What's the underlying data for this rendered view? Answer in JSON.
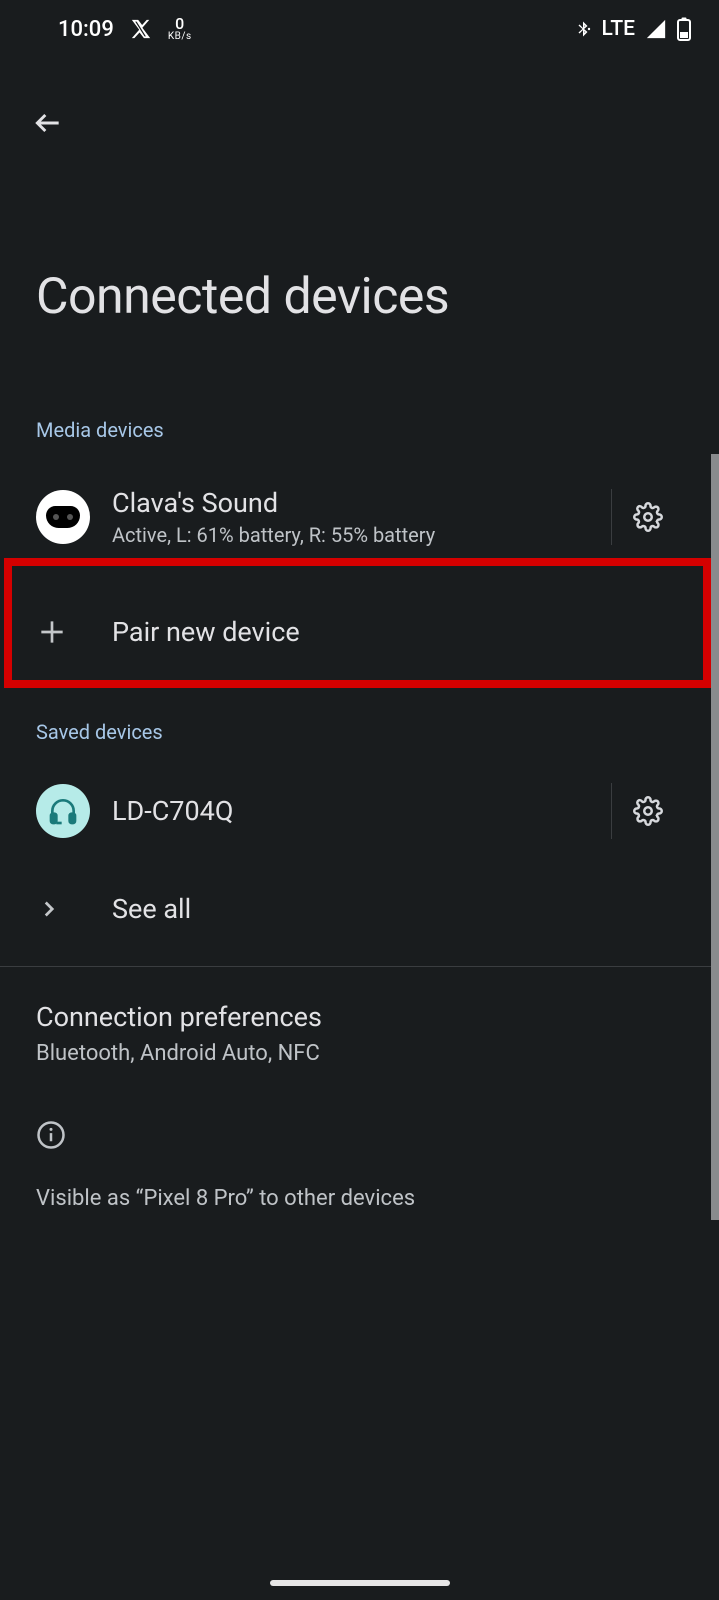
{
  "status": {
    "time": "10:09",
    "speed_value": "0",
    "speed_unit": "KB/s",
    "network": "LTE"
  },
  "page": {
    "title": "Connected devices"
  },
  "sections": {
    "media_label": "Media devices",
    "saved_label": "Saved devices"
  },
  "media_device": {
    "name": "Clava's Sound",
    "status": "Active, L: 61% battery, R: 55% battery"
  },
  "pair": {
    "label": "Pair new device"
  },
  "saved_device": {
    "name": "LD-C704Q"
  },
  "see_all": {
    "label": "See all"
  },
  "conn_pref": {
    "title": "Connection preferences",
    "sub": "Bluetooth, Android Auto, NFC"
  },
  "info": {
    "text": "Visible as “Pixel 8 Pro” to other devices"
  }
}
